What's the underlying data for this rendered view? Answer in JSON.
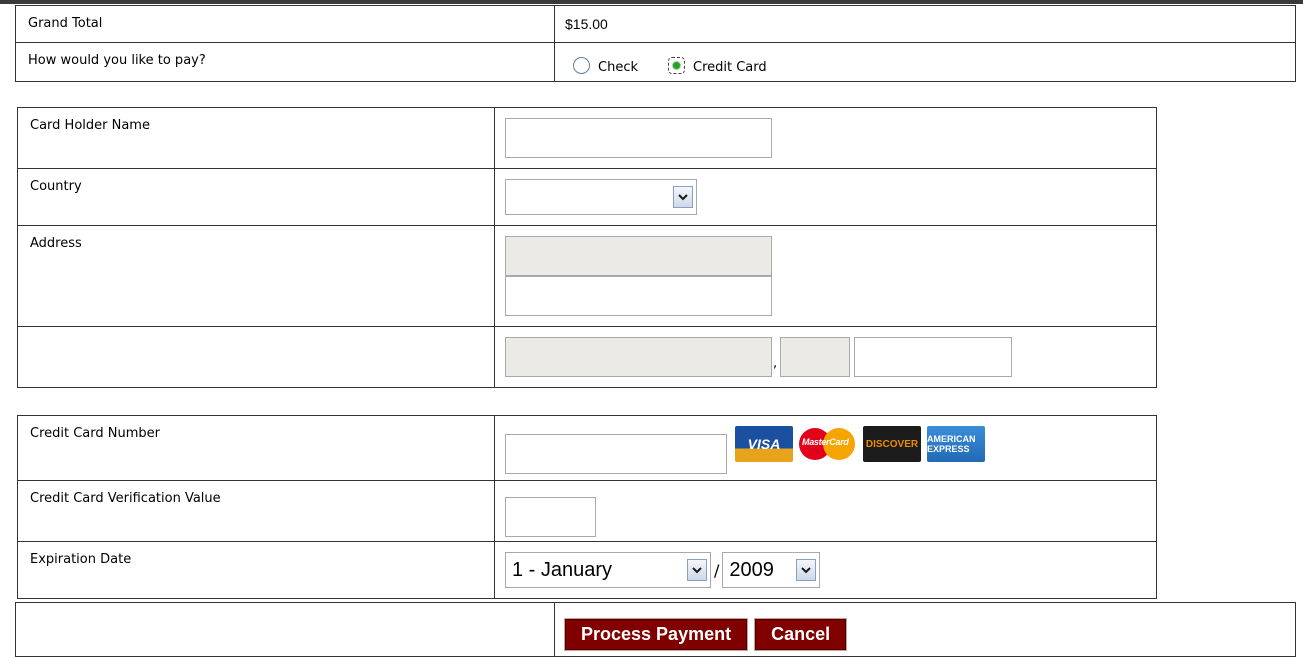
{
  "summary": {
    "grand_total_label": "Grand Total",
    "grand_total_value": "$15.00",
    "pay_question": "How would you like to pay?",
    "pay_options": [
      {
        "label": "Check",
        "selected": false
      },
      {
        "label": "Credit Card",
        "selected": true
      }
    ]
  },
  "billing": {
    "card_holder_label": "Card Holder Name",
    "card_holder_value": "",
    "country_label": "Country",
    "country_value": "",
    "address_label": "Address",
    "address_line1": "",
    "address_line2": "",
    "city_label": "",
    "city_value": "",
    "city_separator": ",",
    "state_value": "",
    "zip_value": ""
  },
  "card": {
    "number_label": "Credit Card Number",
    "number_value": "",
    "cvv_label": "Credit Card Verification Value",
    "cvv_value": "",
    "expiration_label": "Expiration Date",
    "month_value": "1 - January",
    "date_separator": "/",
    "year_value": "2009",
    "logos": [
      "VISA",
      "MasterCard",
      "DISCOVER",
      "AMERICAN EXPRESS"
    ]
  },
  "actions": {
    "process_label": "Process Payment",
    "cancel_label": "Cancel"
  },
  "colors": {
    "button_bg": "#800000",
    "disabled_field_bg": "#ebeae4",
    "border": "#333333"
  }
}
